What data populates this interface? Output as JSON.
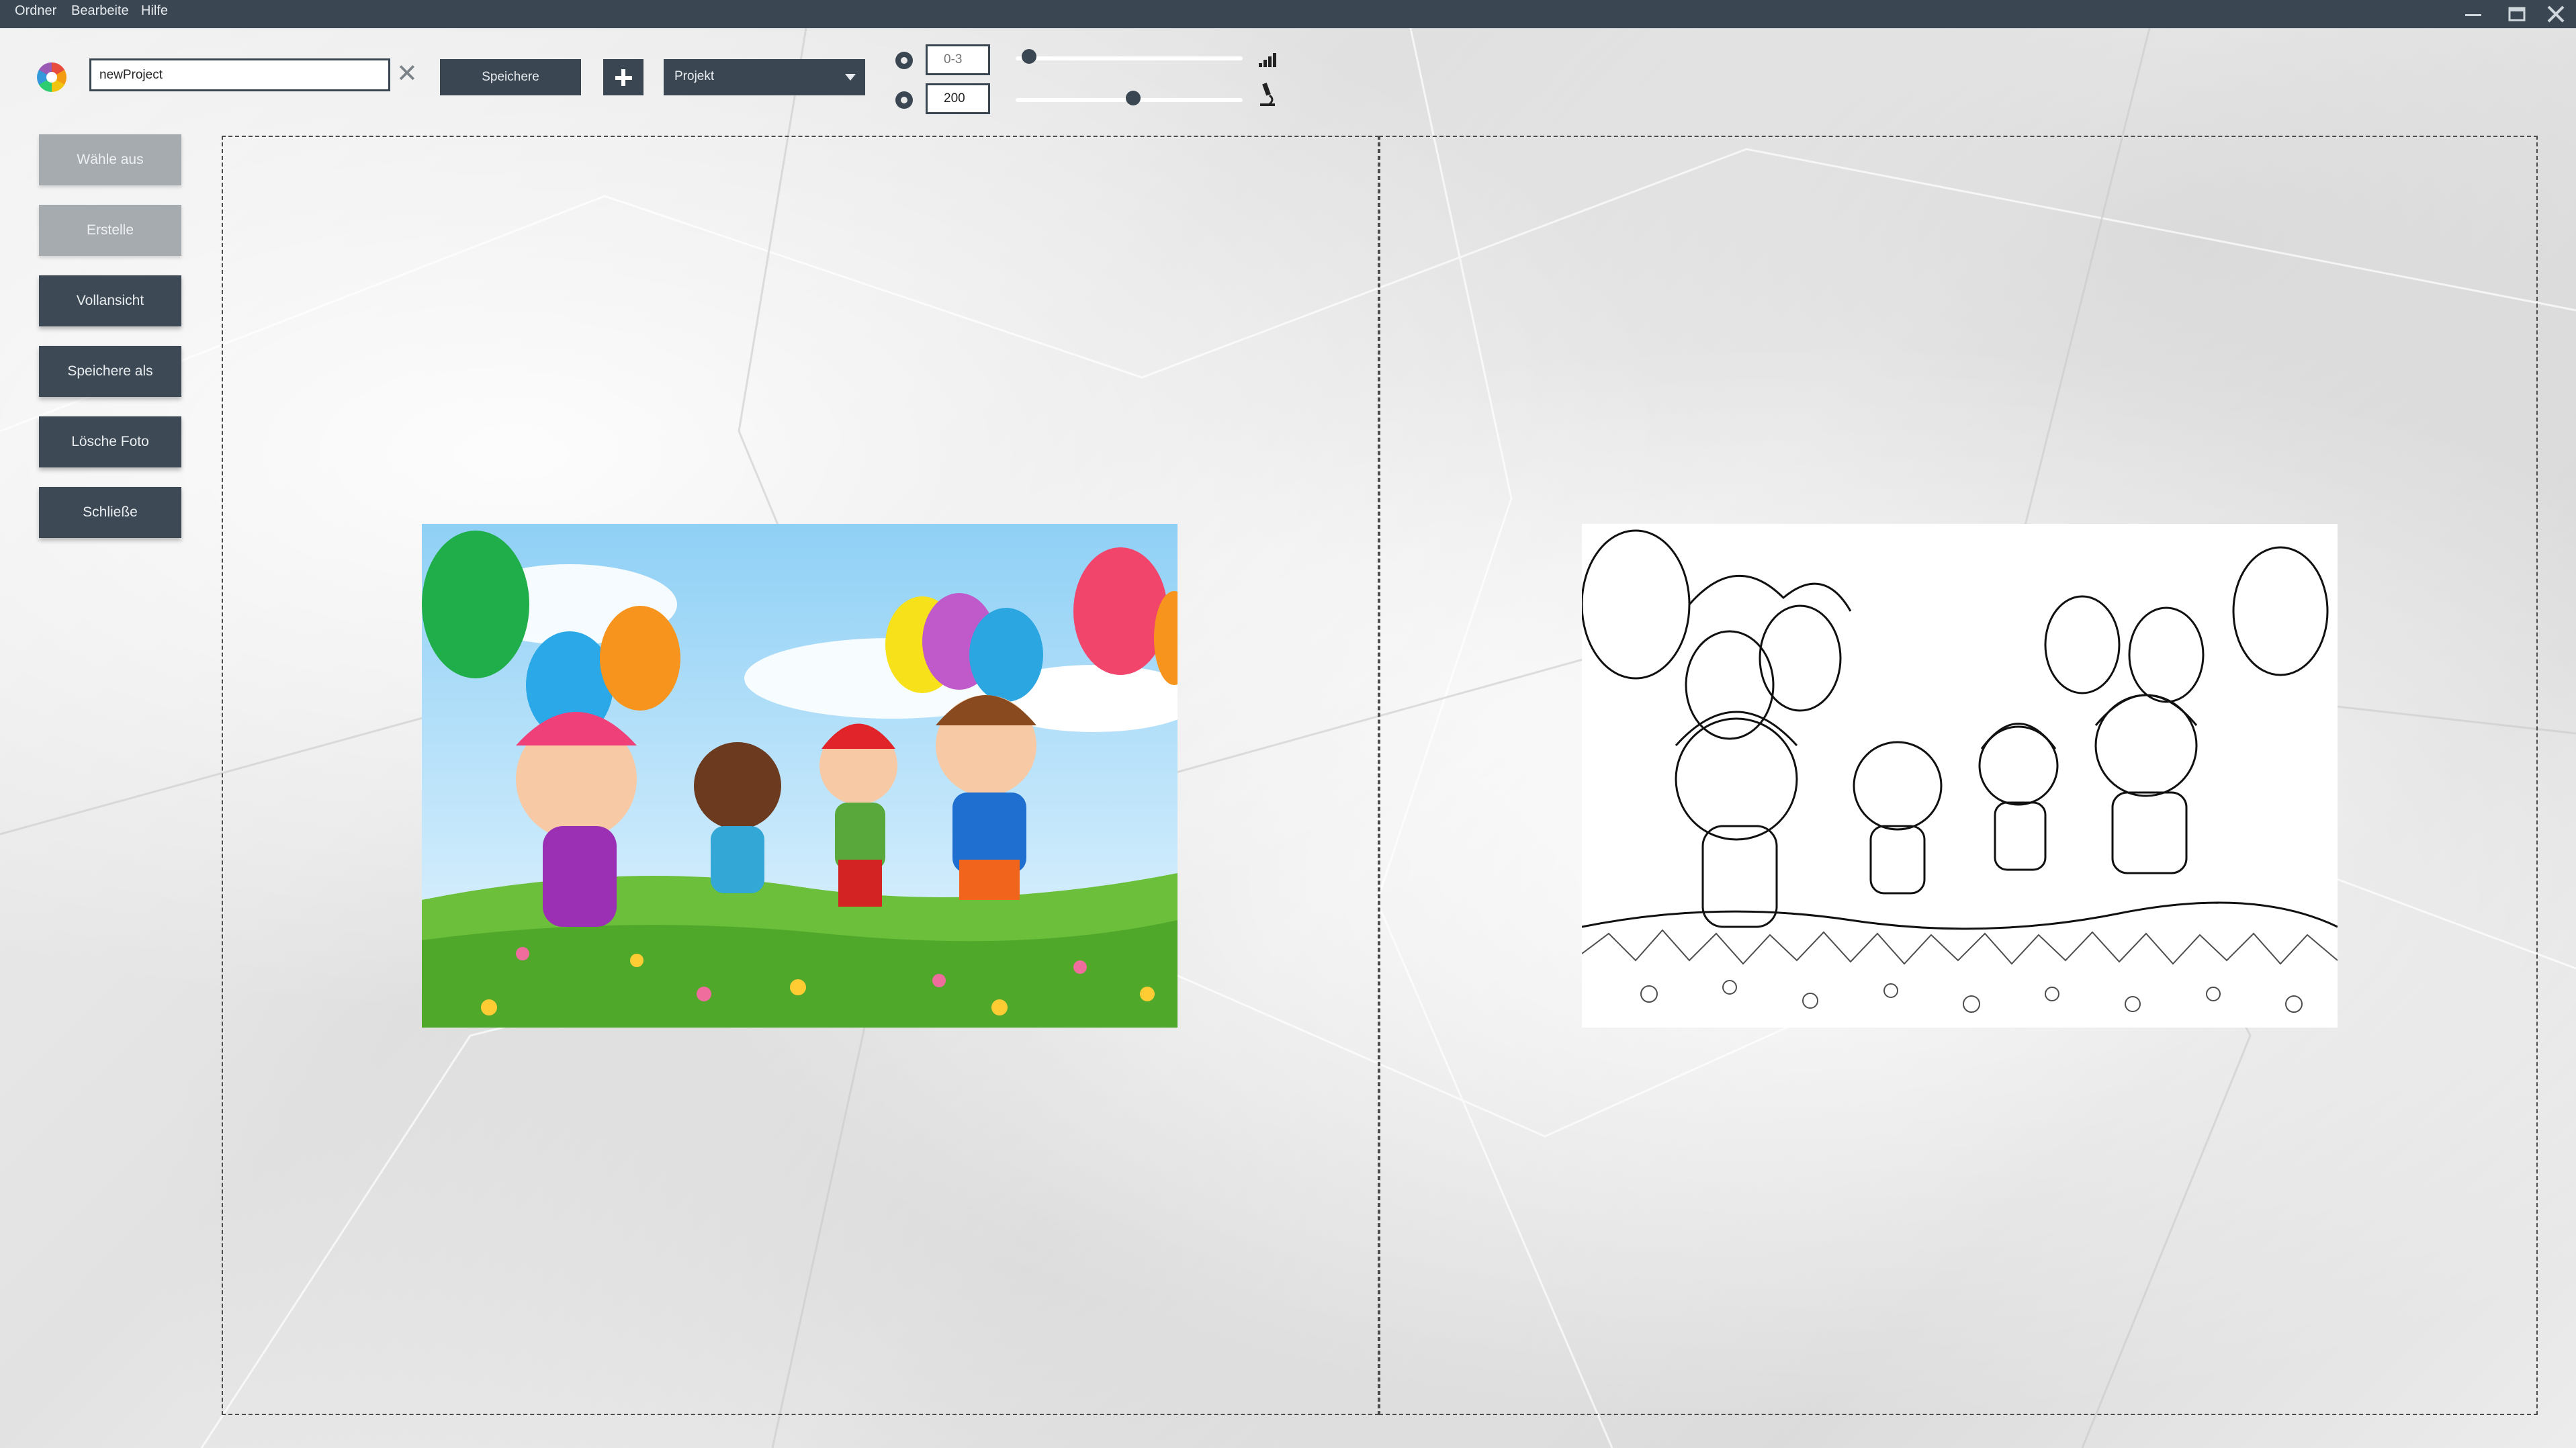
{
  "menu": {
    "items": [
      "Ordner",
      "Bearbeite",
      "Hilfe"
    ]
  },
  "toolbar": {
    "project_name_value": "newProject",
    "save_label": "Speichere",
    "project_select_value": "Projekt",
    "field1_placeholder": "0-3",
    "field2_value": "200",
    "slider1_level": 0.03,
    "slider2_level": 0.52
  },
  "sidebar": {
    "items": [
      {
        "label": "Wähle aus",
        "enabled": false
      },
      {
        "label": "Erstelle",
        "enabled": false
      },
      {
        "label": "Vollansicht",
        "enabled": true
      },
      {
        "label": "Speichere als",
        "enabled": true
      },
      {
        "label": "Lösche Foto",
        "enabled": true
      },
      {
        "label": "Schließe",
        "enabled": true
      }
    ]
  },
  "colors": {
    "chrome": "#3a4651",
    "disabled_button": "#a6abb0"
  },
  "icons": {
    "clear": "close-icon",
    "add": "plus-icon",
    "slider1": "signal-bars-icon",
    "slider2": "microscope-icon"
  }
}
